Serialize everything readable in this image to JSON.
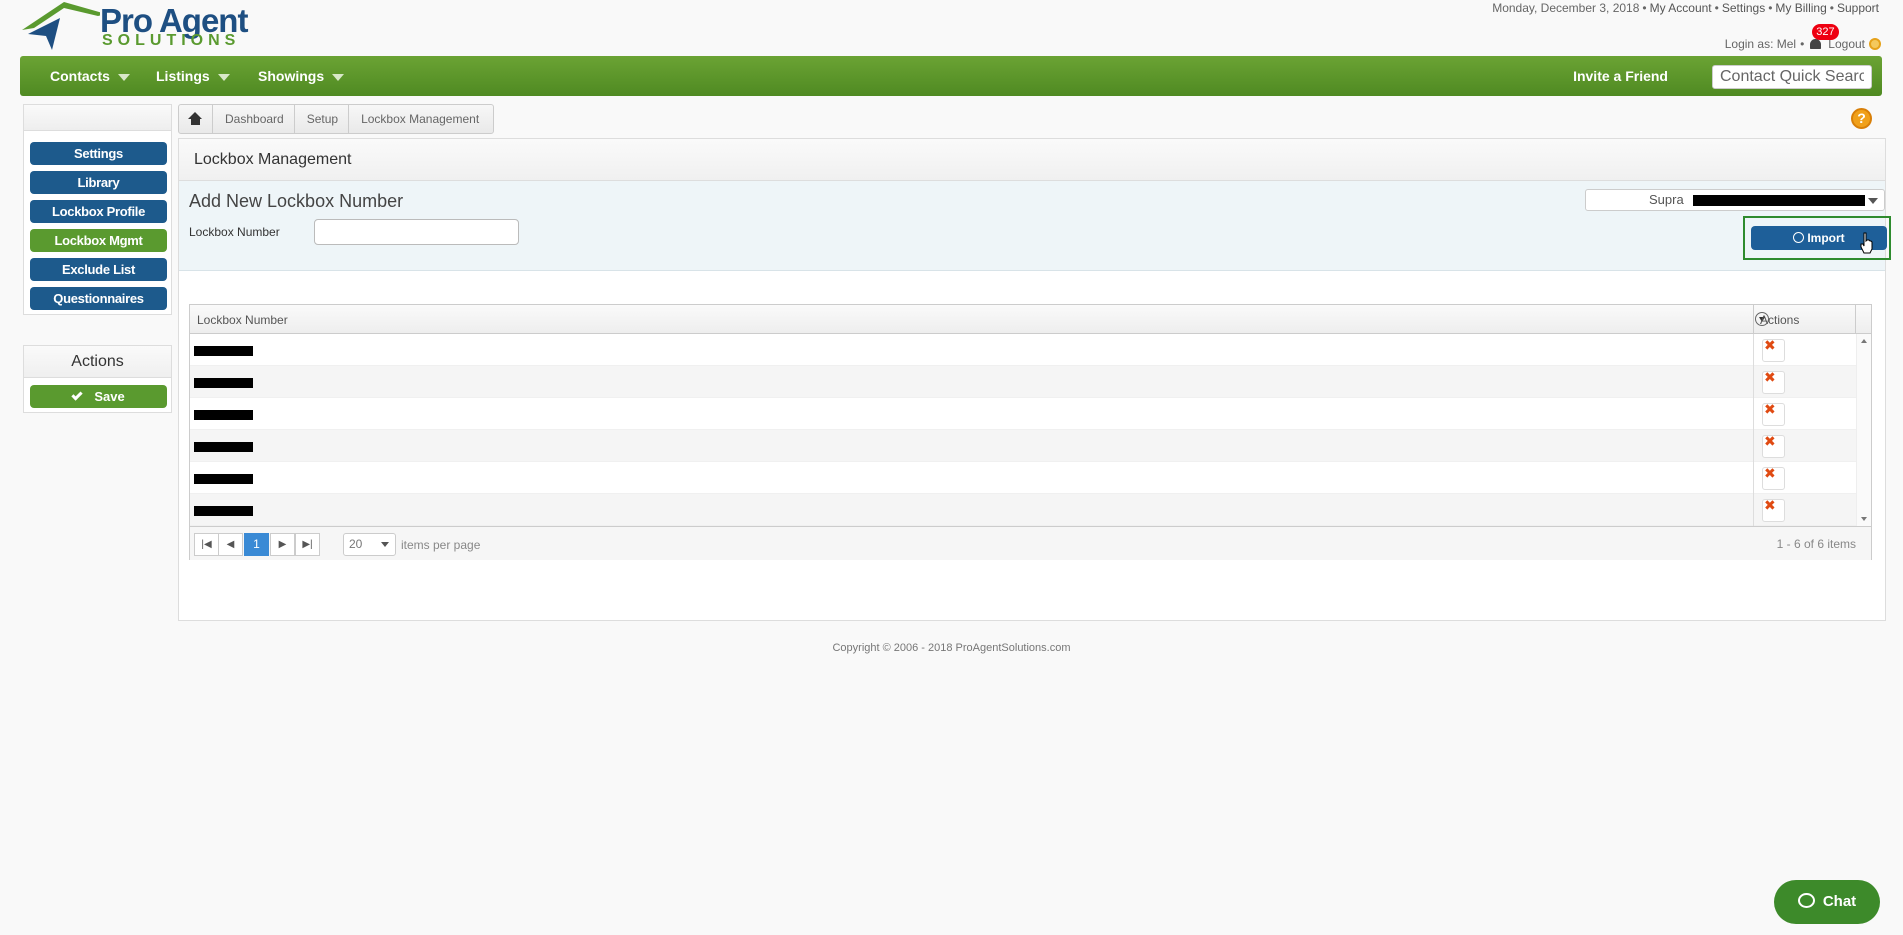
{
  "brand": {
    "name": "Pro Agent",
    "sub": "SOLUTIONS"
  },
  "header": {
    "date": "Monday, December 3, 2018",
    "links": [
      "My Account",
      "Settings",
      "My Billing",
      "Support"
    ],
    "login_as": "Login as: Mel",
    "notification_count": "327",
    "logout": "Logout"
  },
  "nav": {
    "items": [
      "Contacts",
      "Listings",
      "Showings"
    ],
    "invite": "Invite a Friend",
    "quick_search_placeholder": "Contact Quick Search"
  },
  "sidebar": {
    "items": [
      {
        "label": "Settings",
        "active": false
      },
      {
        "label": "Library",
        "active": false
      },
      {
        "label": "Lockbox Profile",
        "active": false
      },
      {
        "label": "Lockbox Mgmt",
        "active": true
      },
      {
        "label": "Exclude List",
        "active": false
      },
      {
        "label": "Questionnaires",
        "active": false
      }
    ],
    "actions_title": "Actions",
    "save_label": "Save"
  },
  "breadcrumb": [
    "Dashboard",
    "Setup",
    "Lockbox Management"
  ],
  "main": {
    "title": "Lockbox Management",
    "add_title": "Add New Lockbox Number",
    "lockbox_label": "Lockbox Number",
    "lockbox_value": "",
    "supra_select": "Supra",
    "import_label": "Import"
  },
  "grid": {
    "col_lockbox": "Lockbox Number",
    "col_actions": "Actions",
    "rows": [
      "",
      "",
      "",
      "",
      "",
      ""
    ],
    "page": "1",
    "per_page": "20",
    "per_page_label": "items per page",
    "info": "1 - 6 of 6 items"
  },
  "footer": "Copyright © 2006 - 2018 ProAgentSolutions.com",
  "chat": "Chat",
  "colors": {
    "nav_green": "#5a9a2f",
    "sidebar_blue": "#1d5a8c",
    "import_blue": "#1e5f99",
    "delete_orange": "#e04a12"
  }
}
